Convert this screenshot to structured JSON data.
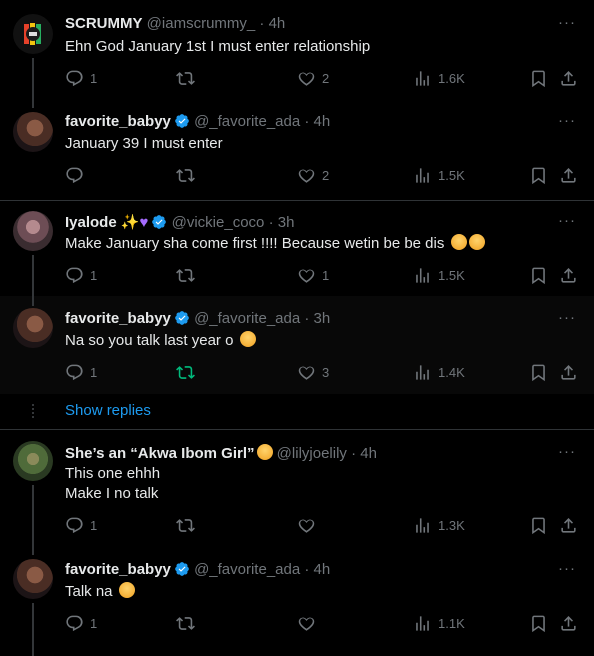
{
  "tweets": [
    {
      "name": "SCRUMMY",
      "handle": "@iamscrummy_",
      "time": "· 4h",
      "text": "Ehn God January 1st I must enter relationship",
      "replies": "1",
      "retweets": "",
      "likes": "2",
      "views": "1.6K",
      "verified": false
    },
    {
      "name": "favorite_babyy",
      "handle": "@_favorite_ada",
      "time": "· 4h",
      "text": "January 39 I must enter",
      "replies": "",
      "retweets": "",
      "likes": "2",
      "views": "1.5K",
      "verified": true
    },
    {
      "name": "Iyalode",
      "handle": "@vickie_coco",
      "time": "· 3h",
      "text": "Make January sha come first !!!! Because wetin be be dis",
      "replies": "1",
      "retweets": "",
      "likes": "1",
      "views": "1.5K",
      "verified": true
    },
    {
      "name": "favorite_babyy",
      "handle": "@_favorite_ada",
      "time": "· 3h",
      "text": "Na so you talk last year o",
      "replies": "1",
      "retweets": "",
      "likes": "3",
      "views": "1.4K",
      "verified": true
    },
    {
      "name": "She’s an “Akwa Ibom Girl”",
      "handle": "@lilyjoelily",
      "time": "· 4h",
      "text_line1": "This one ehhh",
      "text_line2": "Make I no talk",
      "replies": "1",
      "retweets": "",
      "likes": "",
      "views": "1.3K",
      "verified": false
    },
    {
      "name": "favorite_babyy",
      "handle": "@_favorite_ada",
      "time": "· 4h",
      "text": "Talk na",
      "replies": "1",
      "retweets": "",
      "likes": "",
      "views": "1.1K",
      "verified": true
    }
  ],
  "show_replies": "Show replies",
  "more_label": "···",
  "colors": {
    "accent": "#1d9bf0",
    "muted": "#71767b",
    "retweet_active": "#00ba7c",
    "verified": "#1d9bf0"
  }
}
